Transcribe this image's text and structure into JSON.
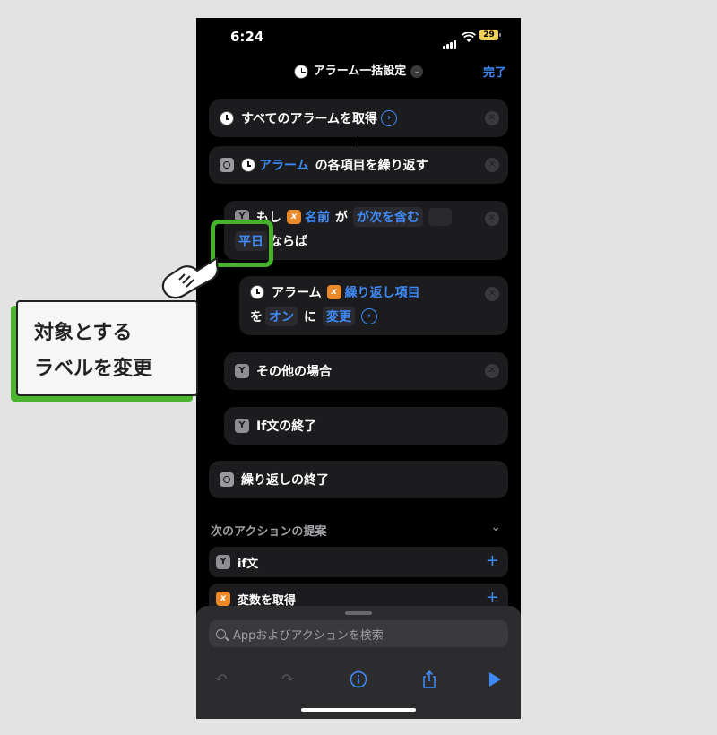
{
  "status": {
    "time": "6:24",
    "battery": "29"
  },
  "nav": {
    "title": "アラーム一括設定",
    "done": "完了"
  },
  "actions": {
    "get_all": {
      "text": "すべてのアラームを取得"
    },
    "repeat": {
      "token": "アラーム",
      "text": "の各項目を繰り返す"
    },
    "if": {
      "prefix": "もし",
      "var": "名前",
      "ga": "が",
      "cond": "が次を含む",
      "value": "平日",
      "suffix": "ならば"
    },
    "set": {
      "prefix": "アラーム",
      "var": "繰り返し項目",
      "wo": "を",
      "value": "オン",
      "ni": "に",
      "verb": "変更"
    },
    "otherwise": {
      "text": "その他の場合"
    },
    "end_if": {
      "text": "If文の終了"
    },
    "end_repeat": {
      "text": "繰り返しの終了"
    }
  },
  "suggestions": {
    "header": "次のアクションの提案",
    "items": [
      {
        "label": "if文"
      },
      {
        "label": "変数を取得"
      }
    ]
  },
  "search": {
    "placeholder": "Appおよびアクションを検索"
  },
  "annotation": {
    "line1": "対象とする",
    "line2": "ラベルを変更"
  },
  "colors": {
    "accent": "#3d8af7",
    "highlight": "#46b22c",
    "variable": "#ec8a2a"
  }
}
